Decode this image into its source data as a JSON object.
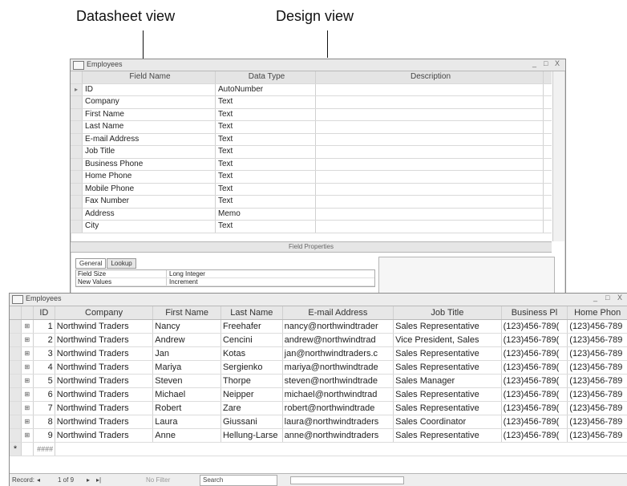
{
  "callouts": {
    "datasheet": "Datasheet view",
    "design": "Design view"
  },
  "design_window": {
    "title": "Employees",
    "controls": [
      "_",
      "□",
      "X"
    ],
    "columns": {
      "field_name": "Field Name",
      "data_type": "Data Type",
      "description": "Description"
    },
    "rows": [
      {
        "field": "ID",
        "type": "AutoNumber"
      },
      {
        "field": "Company",
        "type": "Text"
      },
      {
        "field": "First Name",
        "type": "Text"
      },
      {
        "field": "Last Name",
        "type": "Text"
      },
      {
        "field": "E-mail Address",
        "type": "Text"
      },
      {
        "field": "Job Title",
        "type": "Text"
      },
      {
        "field": "Business Phone",
        "type": "Text"
      },
      {
        "field": "Home Phone",
        "type": "Text"
      },
      {
        "field": "Mobile Phone",
        "type": "Text"
      },
      {
        "field": "Fax Number",
        "type": "Text"
      },
      {
        "field": "Address",
        "type": "Memo"
      },
      {
        "field": "City",
        "type": "Text"
      }
    ],
    "field_properties_label": "Field Properties",
    "tabs": [
      "General",
      "Lookup"
    ],
    "properties": [
      {
        "key": "Field Size",
        "value": "Long Integer"
      },
      {
        "key": "New Values",
        "value": "Increment"
      }
    ]
  },
  "datasheet_window": {
    "title": "Employees",
    "controls": [
      "_",
      "□",
      "X"
    ],
    "headers": [
      "ID",
      "Company",
      "First Name",
      "Last Name",
      "E-mail Address",
      "Job Title",
      "Business Pl",
      "Home Phon"
    ],
    "rows": [
      {
        "id": "1",
        "company": "Northwind Traders",
        "first": "Nancy",
        "last": "Freehafer",
        "email": "nancy@northwindtrader",
        "job": "Sales Representative",
        "bphone": "(123)456-789(",
        "hphone": "(123)456-789"
      },
      {
        "id": "2",
        "company": "Northwind Traders",
        "first": "Andrew",
        "last": "Cencini",
        "email": "andrew@northwindtrad",
        "job": "Vice President, Sales",
        "bphone": "(123)456-789(",
        "hphone": "(123)456-789"
      },
      {
        "id": "3",
        "company": "Northwind Traders",
        "first": "Jan",
        "last": "Kotas",
        "email": "jan@northwindtraders.c",
        "job": "Sales Representative",
        "bphone": "(123)456-789(",
        "hphone": "(123)456-789"
      },
      {
        "id": "4",
        "company": "Northwind Traders",
        "first": "Mariya",
        "last": "Sergienko",
        "email": "mariya@northwindtrade",
        "job": "Sales Representative",
        "bphone": "(123)456-789(",
        "hphone": "(123)456-789"
      },
      {
        "id": "5",
        "company": "Northwind Traders",
        "first": "Steven",
        "last": "Thorpe",
        "email": "steven@northwindtrade",
        "job": "Sales Manager",
        "bphone": "(123)456-789(",
        "hphone": "(123)456-789"
      },
      {
        "id": "6",
        "company": "Northwind Traders",
        "first": "Michael",
        "last": "Neipper",
        "email": "michael@northwindtrad",
        "job": "Sales Representative",
        "bphone": "(123)456-789(",
        "hphone": "(123)456-789"
      },
      {
        "id": "7",
        "company": "Northwind Traders",
        "first": "Robert",
        "last": "Zare",
        "email": "robert@northwindtrade",
        "job": "Sales Representative",
        "bphone": "(123)456-789(",
        "hphone": "(123)456-789"
      },
      {
        "id": "8",
        "company": "Northwind Traders",
        "first": "Laura",
        "last": "Giussani",
        "email": "laura@northwindtraders",
        "job": "Sales Coordinator",
        "bphone": "(123)456-789(",
        "hphone": "(123)456-789"
      },
      {
        "id": "9",
        "company": "Northwind Traders",
        "first": "Anne",
        "last": "Hellung-Larse",
        "email": "anne@northwindtraders",
        "job": "Sales Representative",
        "bphone": "(123)456-789(",
        "hphone": "(123)456-789"
      }
    ],
    "new_row_marker": "*",
    "new_row_id": "####",
    "nav": {
      "label": "Record:",
      "position": "1 of 9",
      "filter": "No Filter",
      "search": "Search"
    }
  }
}
